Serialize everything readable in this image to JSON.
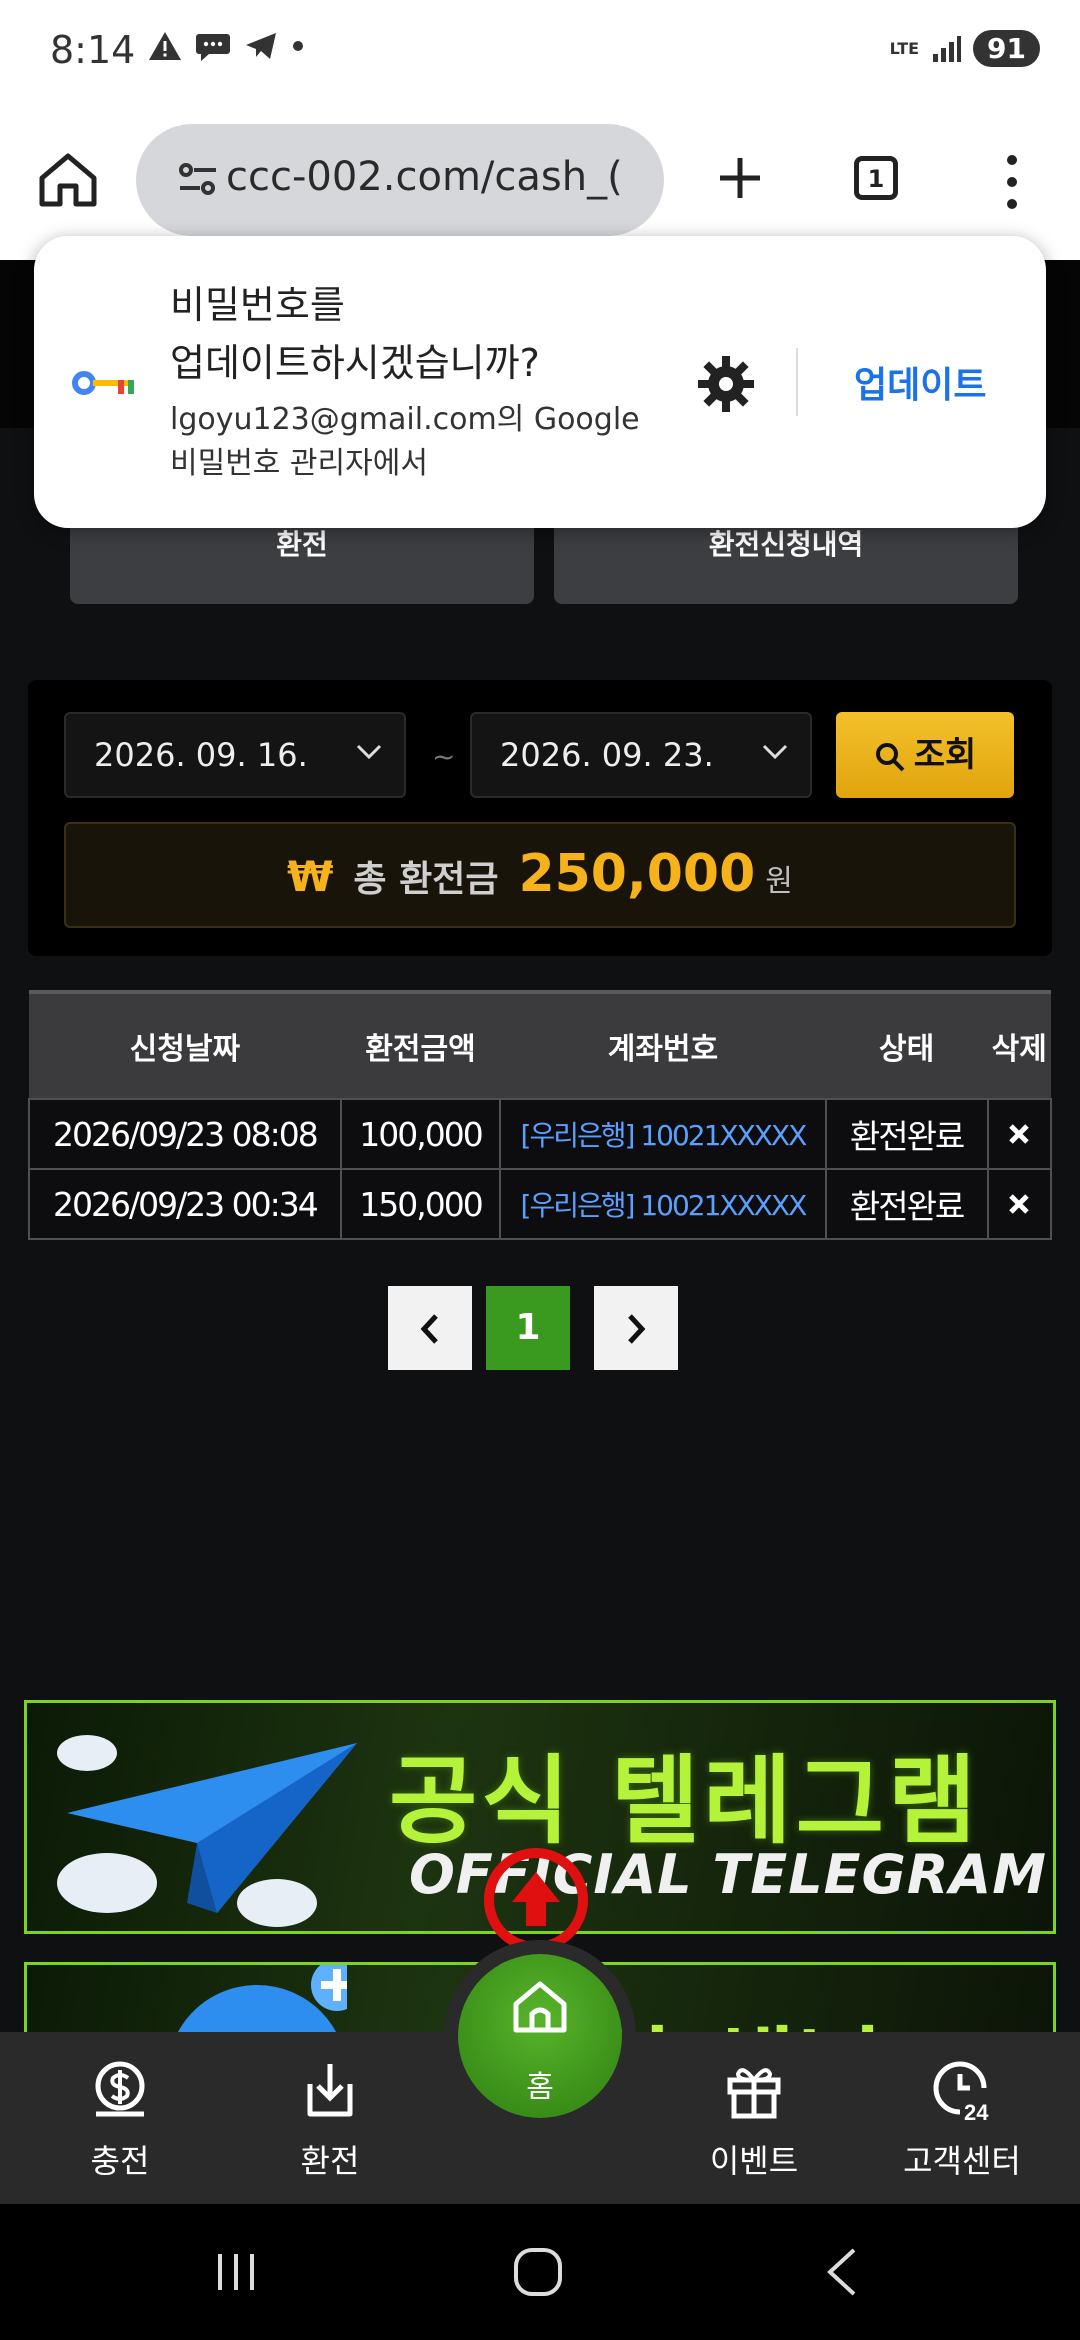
{
  "status_bar": {
    "time": "8:14",
    "network": "LTE",
    "battery": "91"
  },
  "browser": {
    "url": "ccc-002.com/cash_(",
    "tab_count": "1"
  },
  "password_popup": {
    "title_line1": "비밀번호를",
    "title_line2": "업데이트하시겠습니까?",
    "sub_line1": "lgoyu123@gmail.com의 Google",
    "sub_line2": "비밀번호 관리자에서",
    "update_label": "업데이트"
  },
  "page_tabs": {
    "exchange": "환전",
    "exchange_history": "환전신청내역"
  },
  "search": {
    "start_date": "2026. 09. 16.",
    "separator": "~",
    "end_date": "2026. 09. 23.",
    "button_label": "조회"
  },
  "total": {
    "currency_symbol": "₩",
    "label": "총 환전금",
    "value": "250,000",
    "unit": "원"
  },
  "table": {
    "headers": [
      "신청날짜",
      "환전금액",
      "계좌번호",
      "상태",
      "삭제"
    ],
    "rows": [
      {
        "date": "2026/09/23 08:08",
        "amount": "100,000",
        "account": "[우리은행] 10021XXXXX",
        "status": "환전완료"
      },
      {
        "date": "2026/09/23 00:34",
        "amount": "150,000",
        "account": "[우리은행] 10021XXXXX",
        "status": "환전완료"
      }
    ]
  },
  "pagination": {
    "current": "1"
  },
  "banners": {
    "telegram_ko": "공식 텔레그램",
    "telegram_en": "OFFICIAL TELEGRAM",
    "channel_ko": "공식 채널"
  },
  "bottom_nav": {
    "charge": "충전",
    "exchange": "환전",
    "home": "홈",
    "event": "이벤트",
    "support": "고객센터"
  },
  "colors": {
    "accent_gold": "#f5b21a",
    "accent_green": "#3a9a1f",
    "link_blue": "#1a73e8"
  }
}
